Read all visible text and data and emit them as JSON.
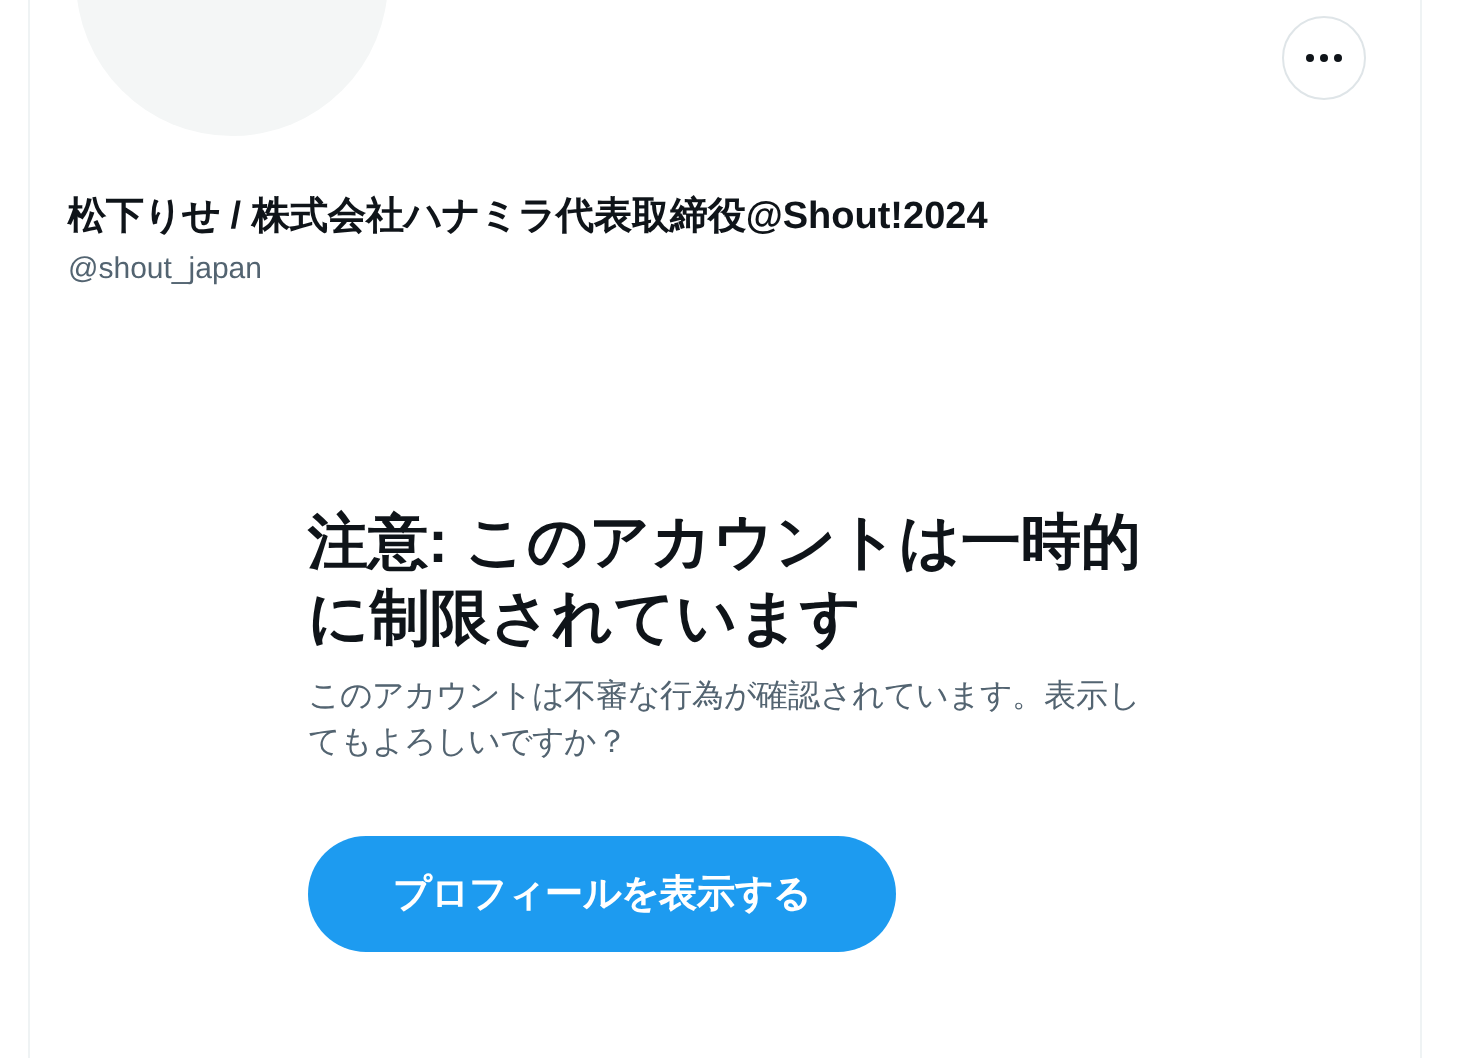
{
  "profile": {
    "name": "松下りせ / 株式会社ハナミラ代表取締役@Shout!2024",
    "handle": "@shout_japan"
  },
  "warning": {
    "title": "注意: このアカウントは一時的に制限されています",
    "message": "このアカウントは不審な行為が確認されています。表示してもよろしいですか？",
    "button": "プロフィールを表示する"
  }
}
